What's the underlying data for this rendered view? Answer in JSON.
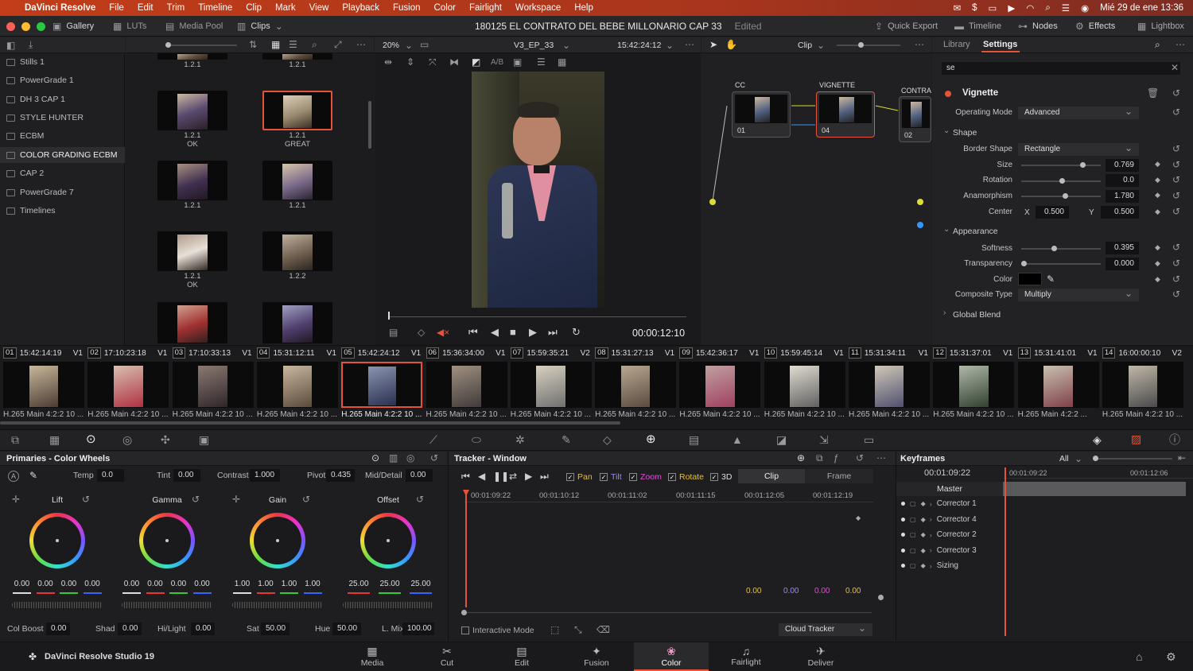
{
  "menubar": {
    "app": "DaVinci Resolve",
    "items": [
      "File",
      "Edit",
      "Trim",
      "Timeline",
      "Clip",
      "Mark",
      "View",
      "Playback",
      "Fusion",
      "Color",
      "Fairlight",
      "Workspace",
      "Help"
    ],
    "datetime": "Mié 29 de ene  13:36"
  },
  "titlebar": {
    "gallery": "Gallery",
    "luts": "LUTs",
    "media_pool": "Media Pool",
    "clips": "Clips",
    "project_title": "180125 EL CONTRATO DEL BEBE MILLONARIO CAP 33",
    "edited": "Edited",
    "quick_export": "Quick Export",
    "timeline": "Timeline",
    "nodes": "Nodes",
    "effects": "Effects",
    "lightbox": "Lightbox"
  },
  "gallery": {
    "albums": [
      "Stills 1",
      "PowerGrade 1",
      "DH 3 CAP 1",
      "STYLE HUNTER",
      "ECBM",
      "COLOR GRADING ECBM",
      "CAP 2",
      "PowerGrade 7",
      "Timelines"
    ],
    "selected_album": "COLOR GRADING ECBM",
    "stills": [
      {
        "n": "1.2.1",
        "sub": ""
      },
      {
        "n": "1.2.1",
        "sub": ""
      },
      {
        "n": "1.2.1",
        "sub": "OK"
      },
      {
        "n": "1.2.1",
        "sub": "GREAT"
      },
      {
        "n": "1.2.1",
        "sub": ""
      },
      {
        "n": "1.2.1",
        "sub": ""
      },
      {
        "n": "1.2.1",
        "sub": "OK"
      },
      {
        "n": "1.2.2",
        "sub": ""
      }
    ]
  },
  "viewer": {
    "zoom": "20%",
    "timeline_name": "V3_EP_33",
    "timecode": "15:42:24:12",
    "playhead_tc": "00:00:12:10",
    "ab": "A/B"
  },
  "nodes": {
    "mode": "Clip",
    "list": [
      {
        "title": "CC",
        "num": "01"
      },
      {
        "title": "VIGNETTE",
        "num": "04"
      },
      {
        "title": "CONTRA",
        "num": "02"
      }
    ]
  },
  "settings": {
    "tab_library": "Library",
    "tab_settings": "Settings",
    "search_value": "se",
    "effect_name": "Vignette",
    "operating_mode_label": "Operating Mode",
    "operating_mode": "Advanced",
    "shape_section": "Shape",
    "border_shape_label": "Border Shape",
    "border_shape": "Rectangle",
    "size_label": "Size",
    "size": "0.769",
    "size_frac": 0.769,
    "rotation_label": "Rotation",
    "rotation": "0.0",
    "rotation_frac": 0.5,
    "anamorphism_label": "Anamorphism",
    "anamorphism": "1.780",
    "anamorphism_frac": 0.54,
    "center_label": "Center",
    "x_label": "X",
    "center_x": "0.500",
    "y_label": "Y",
    "center_y": "0.500",
    "appearance_section": "Appearance",
    "softness_label": "Softness",
    "softness": "0.395",
    "softness_frac": 0.395,
    "transparency_label": "Transparency",
    "transparency": "0.000",
    "transparency_frac": 0.0,
    "color_label": "Color",
    "color_value": "#000000",
    "composite_label": "Composite Type",
    "composite": "Multiply",
    "global_blend": "Global Blend"
  },
  "clips": [
    {
      "n": "01",
      "tc": "15:42:14:19",
      "t": "V1",
      "c": "H.265 Main 4:2:2 10 ..."
    },
    {
      "n": "02",
      "tc": "17:10:23:18",
      "t": "V1",
      "c": "H.265 Main 4:2:2 10 ..."
    },
    {
      "n": "03",
      "tc": "17:10:33:13",
      "t": "V1",
      "c": "H.265 Main 4:2:2 10 ..."
    },
    {
      "n": "04",
      "tc": "15:31:12:11",
      "t": "V1",
      "c": "H.265 Main 4:2:2 10 ..."
    },
    {
      "n": "05",
      "tc": "15:42:24:12",
      "t": "V1",
      "c": "H.265 Main 4:2:2 10 ..."
    },
    {
      "n": "06",
      "tc": "15:36:34:00",
      "t": "V1",
      "c": "H.265 Main 4:2:2 10 ..."
    },
    {
      "n": "07",
      "tc": "15:59:35:21",
      "t": "V2",
      "c": "H.265 Main 4:2:2 10 ..."
    },
    {
      "n": "08",
      "tc": "15:31:27:13",
      "t": "V1",
      "c": "H.265 Main 4:2:2 10 ..."
    },
    {
      "n": "09",
      "tc": "15:42:36:17",
      "t": "V1",
      "c": "H.265 Main 4:2:2 10 ..."
    },
    {
      "n": "10",
      "tc": "15:59:45:14",
      "t": "V1",
      "c": "H.265 Main 4:2:2 10 ..."
    },
    {
      "n": "11",
      "tc": "15:31:34:11",
      "t": "V1",
      "c": "H.265 Main 4:2:2 10 ..."
    },
    {
      "n": "12",
      "tc": "15:31:37:01",
      "t": "V1",
      "c": "H.265 Main 4:2:2 10 ..."
    },
    {
      "n": "13",
      "tc": "15:31:41:01",
      "t": "V1",
      "c": "H.265 Main 4:2:2 ..."
    },
    {
      "n": "14",
      "tc": "16:00:00:10",
      "t": "V2",
      "c": "H.265 Main 4:2:2 10 ..."
    }
  ],
  "primaries": {
    "title": "Primaries - Color Wheels",
    "temp_label": "Temp",
    "temp": "0.0",
    "tint_label": "Tint",
    "tint": "0.00",
    "contrast_label": "Contrast",
    "contrast": "1.000",
    "pivot_label": "Pivot",
    "pivot": "0.435",
    "mid_label": "Mid/Detail",
    "mid": "0.00",
    "wheels": [
      {
        "name": "Lift",
        "v": [
          "0.00",
          "0.00",
          "0.00",
          "0.00"
        ]
      },
      {
        "name": "Gamma",
        "v": [
          "0.00",
          "0.00",
          "0.00",
          "0.00"
        ]
      },
      {
        "name": "Gain",
        "v": [
          "1.00",
          "1.00",
          "1.00",
          "1.00"
        ]
      },
      {
        "name": "Offset",
        "v": [
          "25.00",
          "25.00",
          "25.00"
        ]
      }
    ],
    "colboost_label": "Col Boost",
    "colboost": "0.00",
    "shad_label": "Shad",
    "shad": "0.00",
    "hilight_label": "Hi/Light",
    "hilight": "0.00",
    "sat_label": "Sat",
    "sat": "50.00",
    "hue_label": "Hue",
    "hue": "50.00",
    "lmix_label": "L. Mix",
    "lmix": "100.00"
  },
  "tracker": {
    "title": "Tracker - Window",
    "pan": "Pan",
    "tilt": "Tilt",
    "zoom": "Zoom",
    "rotate": "Rotate",
    "d3": "3D",
    "clip": "Clip",
    "frame": "Frame",
    "ruler": [
      "00:01:09:22",
      "00:01:10:12",
      "00:01:11:02",
      "00:01:11:15",
      "00:01:12:05",
      "00:01:12:19"
    ],
    "vals": [
      "0.00",
      "0.00",
      "0.00",
      "0.00"
    ],
    "interactive": "Interactive Mode",
    "cloud": "Cloud Tracker"
  },
  "keyframes": {
    "title": "Keyframes",
    "filter": "All",
    "tc_current": "00:01:09:22",
    "tc_ruler1": "00:01:09:22",
    "tc_ruler2": "00:01:12:06",
    "master": "Master",
    "rows": [
      "Corrector 1",
      "Corrector 4",
      "Corrector 2",
      "Corrector 3",
      "Sizing"
    ]
  },
  "pages": {
    "brand": "DaVinci Resolve Studio 19",
    "tabs": [
      "Media",
      "Cut",
      "Edit",
      "Fusion",
      "Color",
      "Fairlight",
      "Deliver"
    ],
    "active": "Color"
  },
  "colors": {
    "accent": "#e5533a",
    "panel": "#1c1c1e",
    "header": "#262628"
  }
}
